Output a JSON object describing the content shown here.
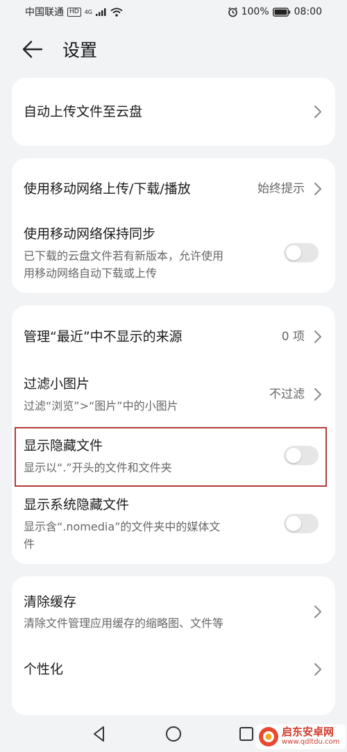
{
  "status_bar": {
    "carrier": "中国联通",
    "hd": "HD",
    "network": "4G",
    "battery": "100%",
    "time": "08:00"
  },
  "header": {
    "title": "设置"
  },
  "cards": {
    "upload": {
      "auto_upload": {
        "title": "自动上传文件至云盘"
      }
    },
    "mobile": {
      "mobile_network": {
        "title": "使用移动网络上传/下载/播放",
        "value": "始终提示"
      },
      "mobile_sync": {
        "title": "使用移动网络保持同步",
        "sub_line1": "已下载的云盘文件若有新版本，允许使用",
        "sub_line2": "用移动网络自动下载或上传",
        "enabled": false
      }
    },
    "display": {
      "recent_sources": {
        "title": "管理“最近”中不显示的来源",
        "value": "0 项"
      },
      "filter_small": {
        "title": "过滤小图片",
        "sub": "过滤“浏览”>“图片”中的小图片",
        "value": "不过滤"
      },
      "show_hidden": {
        "title": "显示隐藏文件",
        "sub": "显示以“.”开头的文件和文件夹",
        "enabled": false
      },
      "show_system_hidden": {
        "title": "显示系统隐藏文件",
        "sub_line1": "显示含“.nomedia”的文件夹中的媒体文",
        "sub_line2": "件",
        "enabled": false
      }
    },
    "misc": {
      "clear_cache": {
        "title": "清除缓存",
        "sub": "清除文件管理应用缓存的缩略图、文件等"
      },
      "personalize": {
        "title": "个性化"
      }
    }
  },
  "watermark": {
    "name": "启东安卓网",
    "url": "www.qdltdu.com"
  },
  "colors": {
    "background": "#f1f3f5",
    "card": "#ffffff",
    "highlight": "#b23a3a",
    "toggle_off": "#e6e6e6"
  },
  "icons": {
    "back": "arrow-left-icon",
    "chevron": "chevron-right-icon",
    "nav_back": "triangle-back-icon",
    "nav_home": "circle-home-icon",
    "nav_recent": "square-recent-icon"
  }
}
